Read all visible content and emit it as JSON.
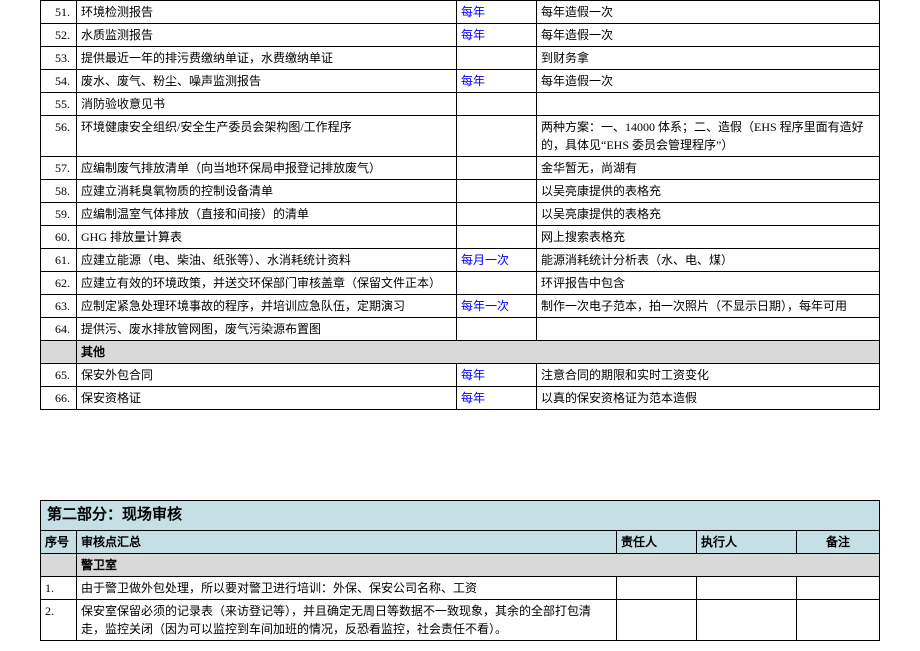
{
  "table1": {
    "rows": [
      {
        "num": "51.",
        "desc": "环境检测报告",
        "freq": "每年",
        "freq_blue": true,
        "note": "每年造假一次"
      },
      {
        "num": "52.",
        "desc": "水质监测报告",
        "freq": "每年",
        "freq_blue": true,
        "note": "每年造假一次"
      },
      {
        "num": "53.",
        "desc": "提供最近一年的排污费缴纳单证，水费缴纳单证",
        "freq": "",
        "freq_blue": false,
        "note": "到财务拿"
      },
      {
        "num": "54.",
        "desc": "废水、废气、粉尘、噪声监测报告",
        "freq": "每年",
        "freq_blue": true,
        "note": "每年造假一次"
      },
      {
        "num": "55.",
        "desc": "消防验收意见书",
        "freq": "",
        "freq_blue": false,
        "note": ""
      },
      {
        "num": "56.",
        "desc": "环境健康安全组织/安全生产委员会架构图/工作程序",
        "freq": "",
        "freq_blue": false,
        "note": "两种方案：一、14000 体系；二、造假（EHS 程序里面有造好的，具体见“EHS 委员会管理程序”）"
      },
      {
        "num": "57.",
        "desc": "应编制废气排放清单（向当地环保局申报登记排放废气）",
        "freq": "",
        "freq_blue": false,
        "note": "金华暂无，尚湖有"
      },
      {
        "num": "58.",
        "desc": "应建立消耗臭氧物质的控制设备清单",
        "freq": "",
        "freq_blue": false,
        "note": "以吴亮康提供的表格充"
      },
      {
        "num": "59.",
        "desc": "应编制温室气体排放（直接和间接）的清单",
        "freq": "",
        "freq_blue": false,
        "note": "以吴亮康提供的表格充"
      },
      {
        "num": "60.",
        "desc": "GHG 排放量计算表",
        "freq": "",
        "freq_blue": false,
        "note": "网上搜索表格充"
      },
      {
        "num": "61.",
        "desc": "应建立能源（电、柴油、纸张等）、水消耗统计资料",
        "freq": "每月一次",
        "freq_blue": true,
        "note": "能源消耗统计分析表（水、电、煤）"
      },
      {
        "num": "62.",
        "desc": "应建立有效的环境政策，并送交环保部门审核盖章（保留文件正本）",
        "freq": "",
        "freq_blue": false,
        "note": "环评报告中包含"
      },
      {
        "num": "63.",
        "desc": "应制定紧急处理环境事故的程序，并培训应急队伍，定期演习",
        "freq": "每年一次",
        "freq_blue": true,
        "note": "制作一次电子范本，拍一次照片（不显示日期），每年可用"
      },
      {
        "num": "64.",
        "desc": "提供污、废水排放管网图，废气污染源布置图",
        "freq": "",
        "freq_blue": false,
        "note": ""
      }
    ],
    "section_other": "其他",
    "rows_after": [
      {
        "num": "65.",
        "desc": "保安外包合同",
        "freq": "每年",
        "freq_blue": true,
        "note": "注意合同的期限和实时工资变化"
      },
      {
        "num": "66.",
        "desc": "保安资格证",
        "freq": "每年",
        "freq_blue": true,
        "note": "以真的保安资格证为范本造假"
      }
    ]
  },
  "part2": {
    "title": "第二部分：现场审核",
    "headers": {
      "c1": "序号",
      "c2": "审核点汇总",
      "c3": "责任人",
      "c4": "执行人",
      "c5": "备注"
    },
    "section": "警卫室",
    "rows": [
      {
        "num": "1.",
        "desc": "由于警卫做外包处理，所以要对警卫进行培训：外保、保安公司名称、工资",
        "c3": "",
        "c4": "",
        "c5": ""
      },
      {
        "num": "2.",
        "desc": "保安室保留必须的记录表（来访登记等），并且确定无周日等数据不一致现象，其余的全部打包清走，监控关闭（因为可以监控到车间加班的情况，反恐看监控，社会责任不看）。",
        "c3": "",
        "c4": "",
        "c5": ""
      }
    ]
  }
}
